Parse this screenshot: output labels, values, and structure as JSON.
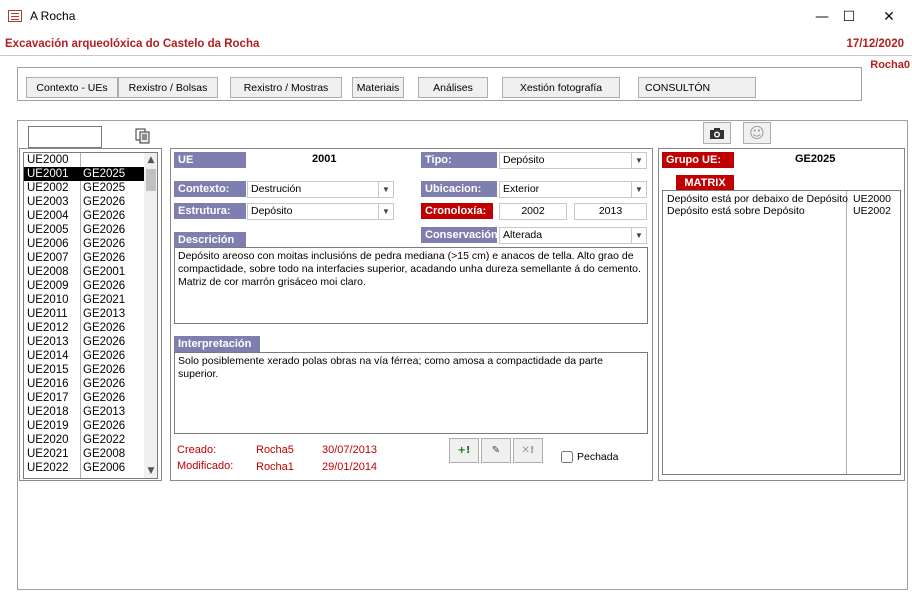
{
  "window": {
    "title": "A Rocha",
    "minimize": "—",
    "maximize": "☐",
    "close": "✕"
  },
  "header": {
    "app_title": "Excavación arqueolóxica do Castelo da Rocha",
    "date": "17/12/2020",
    "user": "Rocha0"
  },
  "nav": {
    "tabs": [
      "Contexto - UEs",
      "Rexistro / Bolsas",
      "Rexistro / Mostras",
      "Materiais",
      "Análises",
      "Xestión fotografía",
      "CONSULTÓN"
    ]
  },
  "list": {
    "search_value": "",
    "selected_index": 1,
    "rows": [
      [
        "UE2000",
        ""
      ],
      [
        "UE2001",
        "GE2025"
      ],
      [
        "UE2002",
        "GE2025"
      ],
      [
        "UE2003",
        "GE2026"
      ],
      [
        "UE2004",
        "GE2026"
      ],
      [
        "UE2005",
        "GE2026"
      ],
      [
        "UE2006",
        "GE2026"
      ],
      [
        "UE2007",
        "GE2026"
      ],
      [
        "UE2008",
        "GE2001"
      ],
      [
        "UE2009",
        "GE2026"
      ],
      [
        "UE2010",
        "GE2021"
      ],
      [
        "UE2011",
        "GE2013"
      ],
      [
        "UE2012",
        "GE2026"
      ],
      [
        "UE2013",
        "GE2026"
      ],
      [
        "UE2014",
        "GE2026"
      ],
      [
        "UE2015",
        "GE2026"
      ],
      [
        "UE2016",
        "GE2026"
      ],
      [
        "UE2017",
        "GE2026"
      ],
      [
        "UE2018",
        "GE2013"
      ],
      [
        "UE2019",
        "GE2026"
      ],
      [
        "UE2020",
        "GE2022"
      ],
      [
        "UE2021",
        "GE2008"
      ],
      [
        "UE2022",
        "GE2006"
      ]
    ]
  },
  "form": {
    "ue_label": "UE",
    "ue_value": "2001",
    "tipo_label": "Tipo:",
    "tipo_value": "Depósito",
    "contexto_label": "Contexto:",
    "contexto_value": "Destrución",
    "ubicacion_label": "Ubicacion:",
    "ubicacion_value": "Exterior",
    "estrutura_label": "Estrutura:",
    "estrutura_value": "Depósito",
    "cronoloxia_label": "Cronoloxía:",
    "cronoloxia_from": "2002",
    "cronoloxia_to": "2013",
    "conservacion_label": "Conservación:",
    "conservacion_value": "Alterada",
    "descricion_label": "Descrición",
    "descricion_text": "Depósito areoso con moitas inclusións de pedra mediana (>15 cm) e anacos de tella. Alto grao de compactidade, sobre todo na interfacies superior, acadando unha dureza semellante á do cemento. Matriz de cor marrón grisáceo moi claro.",
    "interpretacion_label": "Interpretación",
    "interpretacion_text": "Solo posiblemente xerado polas obras na vía férrea; como amosa a compactidade da parte superior.",
    "creado_label": "Creado:",
    "creado_user": "Rocha5",
    "creado_date": "30/07/2013",
    "modificado_label": "Modificado:",
    "modificado_user": "Rocha1",
    "modificado_date": "29/01/2014",
    "add_label": "+!",
    "edit_label": "✎",
    "delete_label": "✕!",
    "pechada_label": "Pechada",
    "pechada_checked": false
  },
  "right": {
    "grupo_label": "Grupo UE:",
    "grupo_value": "GE2025",
    "matrix_label": "MATRIX",
    "matrix_rows": [
      [
        "Depósito está por debaixo de Depósito",
        "UE2000"
      ],
      [
        "Depósito está sobre Depósito",
        "UE2002"
      ]
    ]
  },
  "icons": [
    "app-icon",
    "copy-icon",
    "camera-icon",
    "smile-icon",
    "scroll-up-icon",
    "scroll-down-icon"
  ],
  "colors": {
    "accent": "#b41e1e",
    "label_blue": "#7f7faf",
    "label_red": "#c00000"
  }
}
